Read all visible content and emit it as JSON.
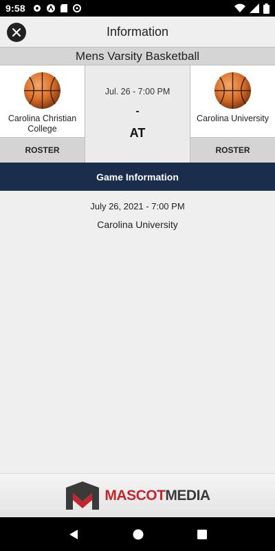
{
  "status_bar": {
    "time": "9:58"
  },
  "app_bar": {
    "title": "Information"
  },
  "sport": "Mens Varsity Basketball",
  "home_team": {
    "name": "Carolina Christian College",
    "roster_label": "ROSTER"
  },
  "away_team": {
    "name": "Carolina University",
    "roster_label": "ROSTER"
  },
  "matchup": {
    "date": "Jul. 26 - 7:00 PM",
    "separator": "-",
    "at_label": "AT"
  },
  "game_info": {
    "header": "Game Information",
    "date": "July 26, 2021 - 7:00 PM",
    "location": "Carolina University"
  },
  "footer": {
    "brand_part1": "MASCOT",
    "brand_part2": "MEDIA"
  },
  "colors": {
    "header_navy": "#1a2d4c",
    "brand_red": "#c4262e",
    "brand_gray": "#3a3a3a"
  },
  "icons": [
    "settings-icon",
    "accessibility-icon",
    "sd-card-icon",
    "sync-icon",
    "wifi-icon",
    "cell-signal-icon",
    "battery-icon",
    "close-icon",
    "basketball-icon",
    "back-nav-icon",
    "home-nav-icon",
    "recents-nav-icon"
  ]
}
